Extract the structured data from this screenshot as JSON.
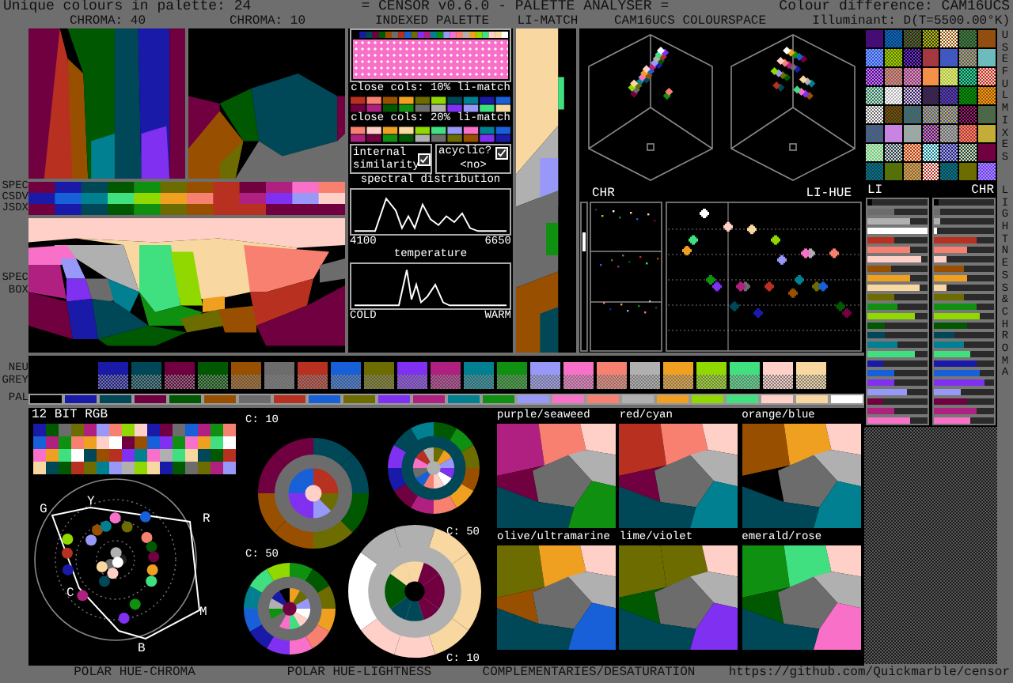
{
  "header": {
    "unique_colours": "Unique colours in palette: 24",
    "title": "= CENSOR v0.6.0 - PALETTE ANALYSER =",
    "colour_difference": "Colour difference: CAM16UCS",
    "illuminant": "Illuminant: D(T=5500.00°K)"
  },
  "panel_titles": {
    "chroma_high": "CHROMA: 40",
    "chroma_low": "CHROMA: 10",
    "indexed_palette": "INDEXED PALETTE",
    "li_match": "LI-MATCH",
    "colourspace": "CAM16UCS COLOURSPACE"
  },
  "side_labels": {
    "bands": [
      "SPEC",
      "CSDV",
      "JSDX"
    ],
    "spec_box": "SPEC BOX",
    "neu_grey": "NEU GREY",
    "pal": "PAL"
  },
  "indexed_palette": {
    "close_10": "close cols: 10% li-match",
    "close_20": "close cols: 20% li-match",
    "internal_similarity": {
      "label": "internal similarity",
      "checked": true
    },
    "acyclic": {
      "label": "acyclic?",
      "checked": true,
      "value": "<no>"
    }
  },
  "spectral": {
    "title": "spectral distribution",
    "min": "4100",
    "max": "6650"
  },
  "temperature": {
    "title": "temperature",
    "cold": "COLD",
    "warm": "WARM"
  },
  "scatter_titles": {
    "chr": "CHR",
    "li_hue": "LI-HUE"
  },
  "right": {
    "useful_mixes": "USEFUL MIXES",
    "li": "LI",
    "chr": "CHR",
    "lightness_chroma": "LIGHTNESS & CHROMA"
  },
  "palette": [
    {
      "color": "#000000"
    },
    {
      "color": "#1a1aa8"
    },
    {
      "color": "#004858"
    },
    {
      "color": "#700040"
    },
    {
      "color": "#005800"
    },
    {
      "color": "#985000"
    },
    {
      "color": "#6c6c6c"
    },
    {
      "color": "#b83020"
    },
    {
      "color": "#1860d8"
    },
    {
      "color": "#6c6c00"
    },
    {
      "color": "#8030f0"
    },
    {
      "color": "#b02080"
    },
    {
      "color": "#008090"
    },
    {
      "color": "#109010"
    },
    {
      "color": "#9898f8"
    },
    {
      "color": "#f870c8"
    },
    {
      "color": "#f88070"
    },
    {
      "color": "#b0b0b0"
    },
    {
      "color": "#f0a020"
    },
    {
      "color": "#90d800"
    },
    {
      "color": "#40e080"
    },
    {
      "color": "#ffd0c8"
    },
    {
      "color": "#f8d8a0"
    },
    {
      "color": "#ffffff"
    }
  ],
  "bars": [
    {
      "color": "#000000",
      "li": {
        "level": 0.08
      },
      "chr": {
        "level": 0.08
      }
    },
    {
      "color": "#6c6c6c",
      "li": {
        "level": 0.45
      },
      "chr": {
        "level": 0.1
      }
    },
    {
      "color": "#b0b0b0",
      "li": {
        "level": 0.7
      },
      "chr": {
        "level": 0.1
      }
    },
    {
      "color": "#ffffff",
      "li": {
        "level": 1.0
      },
      "chr": {
        "level": 0.05
      }
    },
    {
      "color": "#b83020",
      "li": {
        "level": 0.45
      },
      "chr": {
        "level": 0.7
      }
    },
    {
      "color": "#f88070",
      "li": {
        "level": 0.7
      },
      "chr": {
        "level": 0.55
      }
    },
    {
      "color": "#ffd0c8",
      "li": {
        "level": 0.9
      },
      "chr": {
        "level": 0.2
      }
    },
    {
      "color": "#985000",
      "li": {
        "level": 0.4
      },
      "chr": {
        "level": 0.5
      }
    },
    {
      "color": "#f0a020",
      "li": {
        "level": 0.72
      },
      "chr": {
        "level": 0.55
      }
    },
    {
      "color": "#f8d8a0",
      "li": {
        "level": 0.88
      },
      "chr": {
        "level": 0.22
      }
    },
    {
      "color": "#6c6c00",
      "li": {
        "level": 0.45
      },
      "chr": {
        "level": 0.5
      }
    },
    {
      "color": "#109010",
      "li": {
        "level": 0.5
      },
      "chr": {
        "level": 0.7
      }
    },
    {
      "color": "#90d800",
      "li": {
        "level": 0.8
      },
      "chr": {
        "level": 0.75
      }
    },
    {
      "color": "#005800",
      "li": {
        "level": 0.3
      },
      "chr": {
        "level": 0.55
      }
    },
    {
      "color": "#004858",
      "li": {
        "level": 0.3
      },
      "chr": {
        "level": 0.35
      }
    },
    {
      "color": "#008090",
      "li": {
        "level": 0.5
      },
      "chr": {
        "level": 0.5
      }
    },
    {
      "color": "#40e080",
      "li": {
        "level": 0.8
      },
      "chr": {
        "level": 0.6
      }
    },
    {
      "color": "#1a1aa8",
      "li": {
        "level": 0.25
      },
      "chr": {
        "level": 0.7
      }
    },
    {
      "color": "#1860d8",
      "li": {
        "level": 0.45
      },
      "chr": {
        "level": 0.75
      }
    },
    {
      "color": "#8030f0",
      "li": {
        "level": 0.45
      },
      "chr": {
        "level": 0.85
      }
    },
    {
      "color": "#9898f8",
      "li": {
        "level": 0.65
      },
      "chr": {
        "level": 0.45
      }
    },
    {
      "color": "#700040",
      "li": {
        "level": 0.25
      },
      "chr": {
        "level": 0.55
      }
    },
    {
      "color": "#b02080",
      "li": {
        "level": 0.45
      },
      "chr": {
        "level": 0.7
      }
    },
    {
      "color": "#f870c8",
      "li": {
        "level": 0.7
      },
      "chr": {
        "level": 0.6
      }
    }
  ],
  "bottom": {
    "rgb12": "12 BIT RGB",
    "hue_letters": [
      "G",
      "Y",
      "R",
      "C",
      "M",
      "B"
    ],
    "lightness_labels": [
      "C: 10",
      "C: 50",
      "C: 50",
      "C: 10"
    ],
    "complementaries": [
      {
        "title": "purple/seaweed"
      },
      {
        "title": "red/cyan"
      },
      {
        "title": "orange/blue"
      },
      {
        "title": "olive/ultramarine"
      },
      {
        "title": "lime/violet"
      },
      {
        "title": "emerald/rose"
      }
    ],
    "captions": [
      "POLAR HUE-CHROMA",
      "POLAR HUE-LIGHTNESS",
      "COMPLEMENTARIES/DESATURATION"
    ],
    "url": "https://github.com/Quickmarble/censor"
  }
}
